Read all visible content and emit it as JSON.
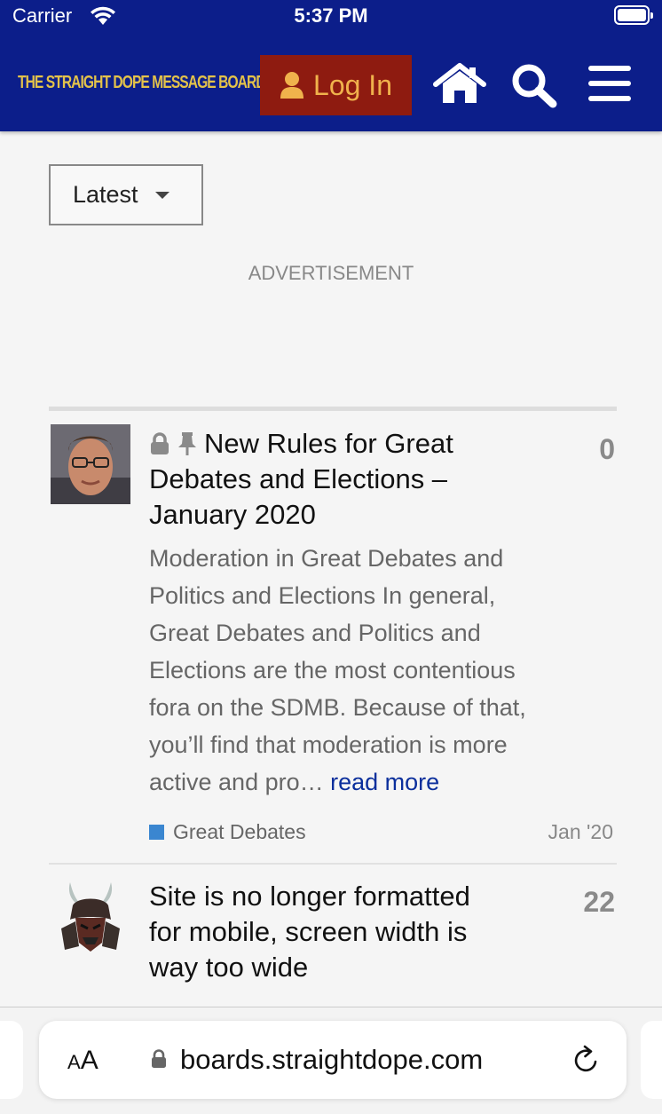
{
  "status_bar": {
    "carrier": "Carrier",
    "time": "5:37 PM"
  },
  "header": {
    "logo_text": "THE STRAIGHT DOPE MESSAGE BOARD",
    "login_label": "Log In",
    "icons": [
      "home-icon",
      "search-icon",
      "hamburger-menu-icon"
    ],
    "bg_color": "#0c1e8a",
    "login_bg": "#8e1b10",
    "accent_color": "#f0b24c"
  },
  "filter": {
    "label": "Latest"
  },
  "advertisement_label": "ADVERTISEMENT",
  "topics": [
    {
      "title": "New Rules for Great Debates and Elections – January 2020",
      "title_lines": [
        "New Rules for Great",
        "Debates and Elections –",
        "January 2020"
      ],
      "icons": [
        "lock-icon",
        "pin-icon"
      ],
      "excerpt_lines": [
        "Moderation in Great Debates and",
        "Politics and Elections In general,",
        "Great Debates and Politics and",
        "Elections are the most contentious",
        "fora on the SDMB. Because of that,",
        "you’ll find that moderation is more"
      ],
      "excerpt_tail": "active and pro…",
      "read_more": "read more",
      "category": "Great Debates",
      "category_color": "#3a86d0",
      "date": "Jan '20",
      "replies": "0"
    },
    {
      "title": "Site is no longer formatted for mobile, screen width is way too wide",
      "title_lines": [
        "Site is no longer formatted",
        "for mobile, screen width is",
        "way too wide"
      ],
      "replies": "22"
    }
  ],
  "browser": {
    "aa_label": "AA",
    "url": "boards.straightdope.com"
  }
}
